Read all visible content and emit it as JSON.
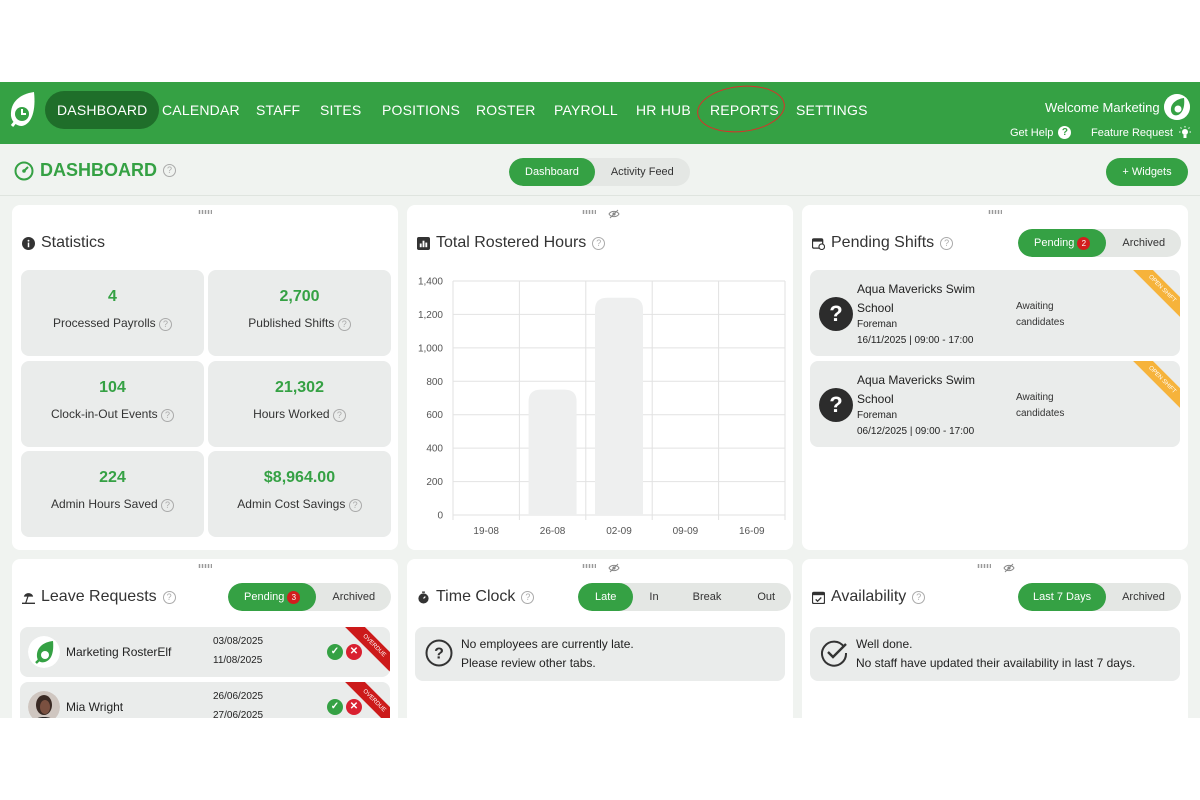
{
  "nav": {
    "items": [
      {
        "label": "DASHBOARD"
      },
      {
        "label": "CALENDAR"
      },
      {
        "label": "STAFF"
      },
      {
        "label": "SITES"
      },
      {
        "label": "POSITIONS"
      },
      {
        "label": "ROSTER"
      },
      {
        "label": "PAYROLL"
      },
      {
        "label": "HR HUB"
      },
      {
        "label": "REPORTS"
      },
      {
        "label": "SETTINGS"
      }
    ],
    "welcome": "Welcome Marketing",
    "get_help": "Get Help",
    "feature_request": "Feature Request"
  },
  "header": {
    "title": "DASHBOARD",
    "tabs": [
      "Dashboard",
      "Activity Feed"
    ],
    "widgets_button": "+ Widgets"
  },
  "statistics": {
    "title": "Statistics",
    "items": [
      {
        "value": "4",
        "label": "Processed Payrolls"
      },
      {
        "value": "2,700",
        "label": "Published Shifts"
      },
      {
        "value": "104",
        "label": "Clock-in-Out Events"
      },
      {
        "value": "21,302",
        "label": "Hours Worked"
      },
      {
        "value": "224",
        "label": "Admin Hours Saved"
      },
      {
        "value": "$8,964.00",
        "label": "Admin Cost Savings"
      }
    ]
  },
  "rostered": {
    "title": "Total Rostered Hours"
  },
  "chart_data": {
    "type": "bar",
    "categories": [
      "19-08",
      "26-08",
      "02-09",
      "09-09",
      "16-09"
    ],
    "values": [
      0,
      750,
      1300,
      0,
      0
    ],
    "ylim": [
      0,
      1400
    ],
    "yticks": [
      "0",
      "200",
      "400",
      "600",
      "800",
      "1,000",
      "1,200",
      "1,400"
    ],
    "grid": true,
    "bar_color": "#eeefef"
  },
  "pending_shifts": {
    "title": "Pending Shifts",
    "tab_pending": "Pending",
    "tab_pending_count": "2",
    "tab_archived": "Archived",
    "items": [
      {
        "site": "Aqua Mavericks Swim School",
        "role": "Foreman",
        "when": "16/11/2025 | 09:00 - 17:00",
        "status": "Awaiting candidates",
        "ribbon": "OPEN SHIFT"
      },
      {
        "site": "Aqua Mavericks Swim School",
        "role": "Foreman",
        "when": "06/12/2025 | 09:00 - 17:00",
        "status": "Awaiting candidates",
        "ribbon": "OPEN SHIFT"
      }
    ]
  },
  "leave": {
    "title": "Leave Requests",
    "tab_pending": "Pending",
    "tab_pending_count": "3",
    "tab_archived": "Archived",
    "items": [
      {
        "name": "Marketing RosterElf",
        "from": "03/08/2025",
        "to": "11/08/2025",
        "ribbon": "OVERDUE"
      },
      {
        "name": "Mia Wright",
        "from": "26/06/2025",
        "to": "27/06/2025",
        "ribbon": "OVERDUE"
      }
    ]
  },
  "timeclock": {
    "title": "Time Clock",
    "tabs": [
      "Late",
      "In",
      "Break",
      "Out"
    ],
    "line1": "No employees are currently late.",
    "line2": "Please review other tabs."
  },
  "availability": {
    "title": "Availability",
    "tab_last7": "Last 7 Days",
    "tab_archived": "Archived",
    "line1": "Well done.",
    "line2": "No staff have updated their availability in last 7 days."
  },
  "colors": {
    "brand": "#35a144",
    "brand_dark": "#1f6e2a",
    "overdue": "#cc1a1a",
    "open_shift": "#f6b33b"
  }
}
